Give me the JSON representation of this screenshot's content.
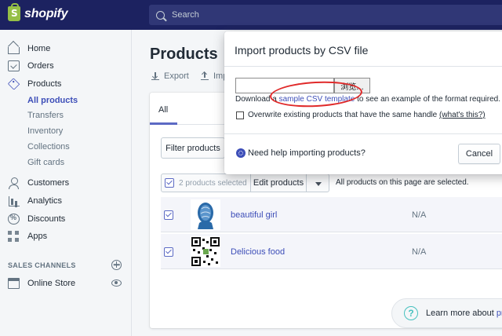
{
  "topbar": {
    "logo_text": "shopify",
    "search_placeholder": "Search"
  },
  "sidebar": {
    "items": [
      {
        "label": "Home",
        "icon": "home-icon"
      },
      {
        "label": "Orders",
        "icon": "orders-icon"
      },
      {
        "label": "Products",
        "icon": "tag-icon"
      },
      {
        "label": "Customers",
        "icon": "customers-icon"
      },
      {
        "label": "Analytics",
        "icon": "analytics-icon"
      },
      {
        "label": "Discounts",
        "icon": "discounts-icon"
      },
      {
        "label": "Apps",
        "icon": "apps-icon"
      }
    ],
    "product_subitems": [
      {
        "label": "All products",
        "active": true
      },
      {
        "label": "Transfers"
      },
      {
        "label": "Inventory"
      },
      {
        "label": "Collections"
      },
      {
        "label": "Gift cards"
      }
    ],
    "sales_channels_heading": "SALES CHANNELS",
    "online_store": "Online Store"
  },
  "main": {
    "page_title": "Products",
    "export_label": "Export",
    "import_label": "Imp",
    "tab_all": "All",
    "filter_label": "Filter products",
    "bulk": {
      "count_label": "2 products selected",
      "edit_label": "Edit products",
      "selection_message": "All products on this page are selected."
    },
    "products": [
      {
        "name": "beautiful girl",
        "inventory": "N/A",
        "checked": true
      },
      {
        "name": "Delicious food",
        "inventory": "N/A",
        "checked": true
      }
    ],
    "learn_more_prefix": "Learn more about ",
    "learn_more_link": "pro"
  },
  "modal": {
    "title": "Import products by CSV file",
    "browse_label": "浏览...",
    "download_prefix": "Download a ",
    "download_link": "sample CSV template",
    "download_suffix": " to see an example of the format required.",
    "overwrite_label": "Overwrite existing products that have the same handle ",
    "whats_this": "(what's this?)",
    "help_text": "Need help importing products?",
    "cancel_label": "Cancel"
  },
  "colors": {
    "topbar": "#1c2260",
    "brand_green": "#95bf47",
    "link": "#3d4eb8",
    "annotation_red": "#e02a2a"
  }
}
